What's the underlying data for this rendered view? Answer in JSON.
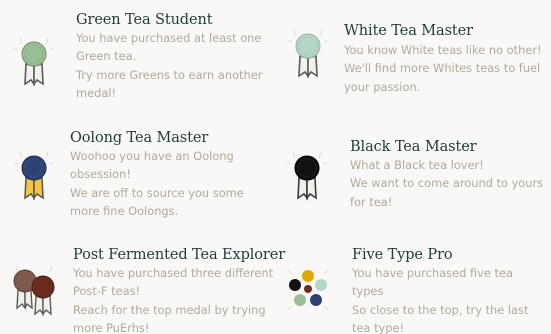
{
  "medals": [
    {
      "title": "Green Tea Student",
      "line1": "You have purchased at least one Green tea.",
      "line2": "Try more Greens to earn another medal!",
      "icon": "green-medal-icon",
      "color": "#9bbf95"
    },
    {
      "title": "White Tea Master",
      "line1": "You know White teas like no other!",
      "line2": "We'll find more Whites teas to fuel your passion.",
      "icon": "white-medal-icon",
      "color": "#b3d6c6"
    },
    {
      "title": "Oolong Tea Master",
      "line1": "Woohoo you have an Oolong obsession!",
      "line2": "We are off to source you some more fine Oolongs.",
      "icon": "oolong-medal-icon",
      "color": "#2f4275"
    },
    {
      "title": "Black Tea Master",
      "line1": "What a Black tea lover!",
      "line2": "We want to come around to yours for tea!",
      "icon": "black-medal-icon",
      "color": "#111111"
    },
    {
      "title": "Post Fermented Tea Explorer",
      "line1": "You have purchased three different Post-F teas!",
      "line2": "Reach for the top medal by trying more PuErhs!",
      "icon": "post-fermented-medal-icon",
      "color": "#6b2a1e"
    },
    {
      "title": "Five Type Pro",
      "line1": "You have purchased five tea types",
      "line2": "So close to the top, try the last tea type!",
      "icon": "five-type-medal-icon",
      "color": "#e0a800"
    }
  ]
}
